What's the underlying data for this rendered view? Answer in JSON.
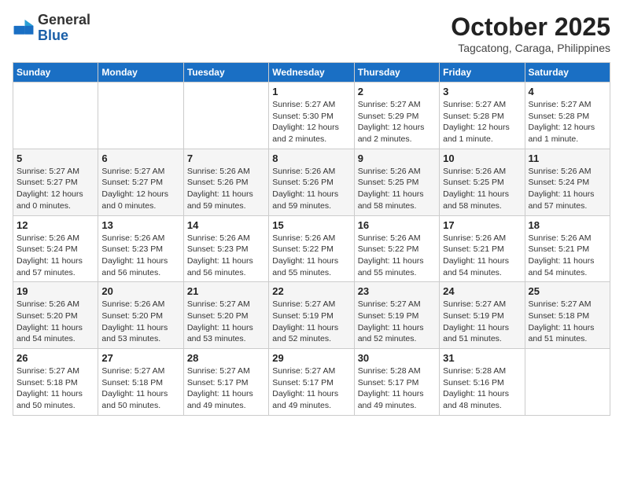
{
  "header": {
    "logo_general": "General",
    "logo_blue": "Blue",
    "month_title": "October 2025",
    "subtitle": "Tagcatong, Caraga, Philippines"
  },
  "weekdays": [
    "Sunday",
    "Monday",
    "Tuesday",
    "Wednesday",
    "Thursday",
    "Friday",
    "Saturday"
  ],
  "weeks": [
    [
      {
        "day": "",
        "info": ""
      },
      {
        "day": "",
        "info": ""
      },
      {
        "day": "",
        "info": ""
      },
      {
        "day": "1",
        "info": "Sunrise: 5:27 AM\nSunset: 5:30 PM\nDaylight: 12 hours\nand 2 minutes."
      },
      {
        "day": "2",
        "info": "Sunrise: 5:27 AM\nSunset: 5:29 PM\nDaylight: 12 hours\nand 2 minutes."
      },
      {
        "day": "3",
        "info": "Sunrise: 5:27 AM\nSunset: 5:28 PM\nDaylight: 12 hours\nand 1 minute."
      },
      {
        "day": "4",
        "info": "Sunrise: 5:27 AM\nSunset: 5:28 PM\nDaylight: 12 hours\nand 1 minute."
      }
    ],
    [
      {
        "day": "5",
        "info": "Sunrise: 5:27 AM\nSunset: 5:27 PM\nDaylight: 12 hours\nand 0 minutes."
      },
      {
        "day": "6",
        "info": "Sunrise: 5:27 AM\nSunset: 5:27 PM\nDaylight: 12 hours\nand 0 minutes."
      },
      {
        "day": "7",
        "info": "Sunrise: 5:26 AM\nSunset: 5:26 PM\nDaylight: 11 hours\nand 59 minutes."
      },
      {
        "day": "8",
        "info": "Sunrise: 5:26 AM\nSunset: 5:26 PM\nDaylight: 11 hours\nand 59 minutes."
      },
      {
        "day": "9",
        "info": "Sunrise: 5:26 AM\nSunset: 5:25 PM\nDaylight: 11 hours\nand 58 minutes."
      },
      {
        "day": "10",
        "info": "Sunrise: 5:26 AM\nSunset: 5:25 PM\nDaylight: 11 hours\nand 58 minutes."
      },
      {
        "day": "11",
        "info": "Sunrise: 5:26 AM\nSunset: 5:24 PM\nDaylight: 11 hours\nand 57 minutes."
      }
    ],
    [
      {
        "day": "12",
        "info": "Sunrise: 5:26 AM\nSunset: 5:24 PM\nDaylight: 11 hours\nand 57 minutes."
      },
      {
        "day": "13",
        "info": "Sunrise: 5:26 AM\nSunset: 5:23 PM\nDaylight: 11 hours\nand 56 minutes."
      },
      {
        "day": "14",
        "info": "Sunrise: 5:26 AM\nSunset: 5:23 PM\nDaylight: 11 hours\nand 56 minutes."
      },
      {
        "day": "15",
        "info": "Sunrise: 5:26 AM\nSunset: 5:22 PM\nDaylight: 11 hours\nand 55 minutes."
      },
      {
        "day": "16",
        "info": "Sunrise: 5:26 AM\nSunset: 5:22 PM\nDaylight: 11 hours\nand 55 minutes."
      },
      {
        "day": "17",
        "info": "Sunrise: 5:26 AM\nSunset: 5:21 PM\nDaylight: 11 hours\nand 54 minutes."
      },
      {
        "day": "18",
        "info": "Sunrise: 5:26 AM\nSunset: 5:21 PM\nDaylight: 11 hours\nand 54 minutes."
      }
    ],
    [
      {
        "day": "19",
        "info": "Sunrise: 5:26 AM\nSunset: 5:20 PM\nDaylight: 11 hours\nand 54 minutes."
      },
      {
        "day": "20",
        "info": "Sunrise: 5:26 AM\nSunset: 5:20 PM\nDaylight: 11 hours\nand 53 minutes."
      },
      {
        "day": "21",
        "info": "Sunrise: 5:27 AM\nSunset: 5:20 PM\nDaylight: 11 hours\nand 53 minutes."
      },
      {
        "day": "22",
        "info": "Sunrise: 5:27 AM\nSunset: 5:19 PM\nDaylight: 11 hours\nand 52 minutes."
      },
      {
        "day": "23",
        "info": "Sunrise: 5:27 AM\nSunset: 5:19 PM\nDaylight: 11 hours\nand 52 minutes."
      },
      {
        "day": "24",
        "info": "Sunrise: 5:27 AM\nSunset: 5:19 PM\nDaylight: 11 hours\nand 51 minutes."
      },
      {
        "day": "25",
        "info": "Sunrise: 5:27 AM\nSunset: 5:18 PM\nDaylight: 11 hours\nand 51 minutes."
      }
    ],
    [
      {
        "day": "26",
        "info": "Sunrise: 5:27 AM\nSunset: 5:18 PM\nDaylight: 11 hours\nand 50 minutes."
      },
      {
        "day": "27",
        "info": "Sunrise: 5:27 AM\nSunset: 5:18 PM\nDaylight: 11 hours\nand 50 minutes."
      },
      {
        "day": "28",
        "info": "Sunrise: 5:27 AM\nSunset: 5:17 PM\nDaylight: 11 hours\nand 49 minutes."
      },
      {
        "day": "29",
        "info": "Sunrise: 5:27 AM\nSunset: 5:17 PM\nDaylight: 11 hours\nand 49 minutes."
      },
      {
        "day": "30",
        "info": "Sunrise: 5:28 AM\nSunset: 5:17 PM\nDaylight: 11 hours\nand 49 minutes."
      },
      {
        "day": "31",
        "info": "Sunrise: 5:28 AM\nSunset: 5:16 PM\nDaylight: 11 hours\nand 48 minutes."
      },
      {
        "day": "",
        "info": ""
      }
    ]
  ]
}
